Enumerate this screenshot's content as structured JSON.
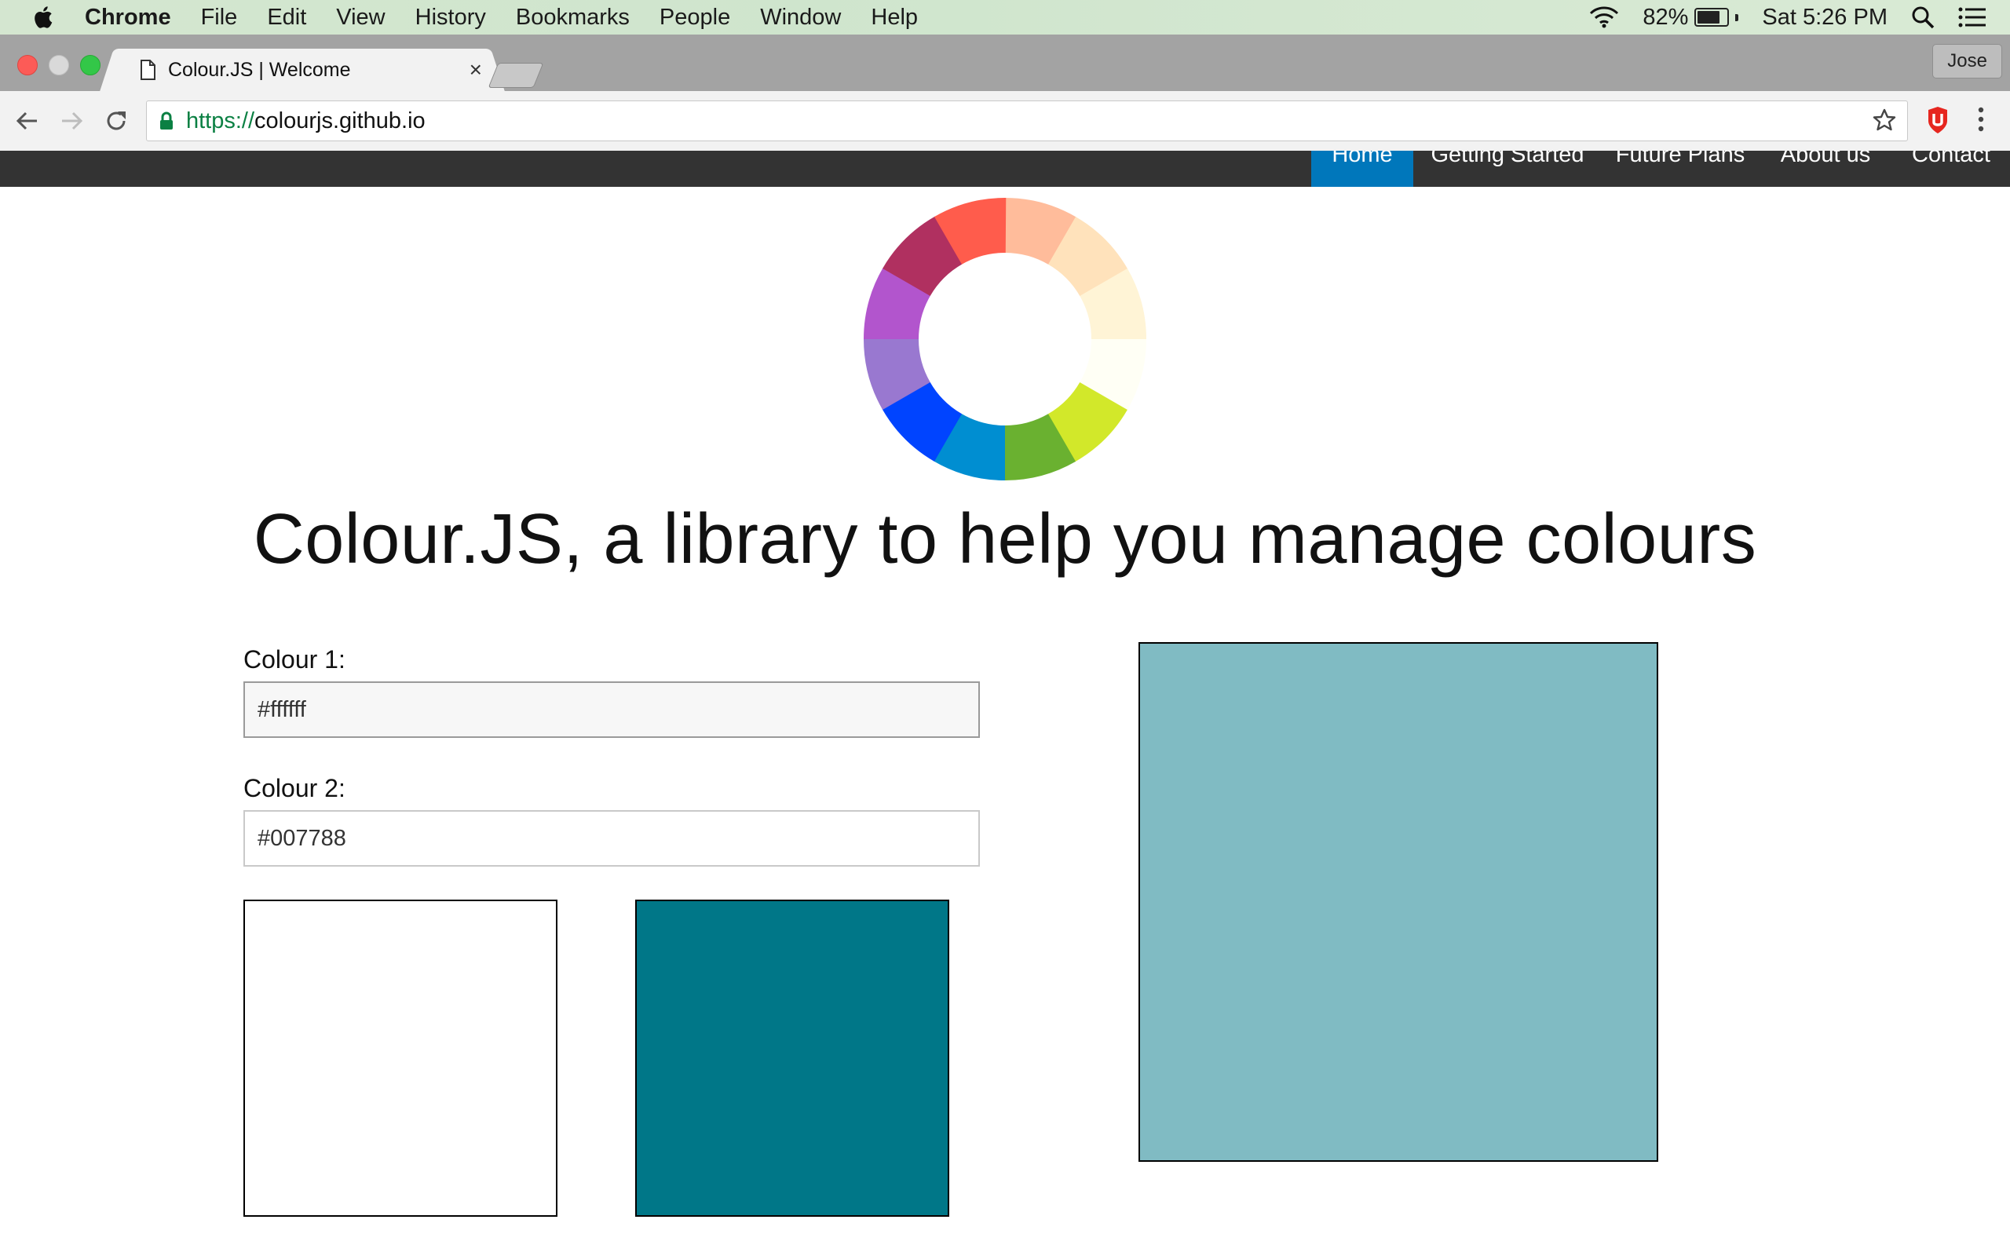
{
  "menubar": {
    "items": [
      "Chrome",
      "File",
      "Edit",
      "View",
      "History",
      "Bookmarks",
      "People",
      "Window",
      "Help"
    ],
    "battery": "82%",
    "battery_level": 0.82,
    "clock": "Sat 5:26 PM",
    "icons": [
      "apple-icon",
      "wifi-icon",
      "battery-icon",
      "spotlight-icon",
      "notification-center-icon"
    ]
  },
  "browser": {
    "tab_title": "Colour.JS | Welcome",
    "tab_close": "×",
    "profile": "Jose",
    "url_scheme": "https://",
    "url_host": "colourjs.github.io"
  },
  "site_nav": {
    "items": [
      "Home",
      "Getting Started",
      "Future Plans",
      "About us",
      "Contact"
    ],
    "active": "Home",
    "active_color": "#0077bb",
    "bar_color": "#333333"
  },
  "logo": {
    "segment_colors": [
      "#ffbc9b",
      "#ffe2bb",
      "#fff4d6",
      "#fffff5",
      "#d2e82a",
      "#6ab130",
      "#008ed1",
      "#0044ff",
      "#9978d0",
      "#b255cd",
      "#b03060",
      "#ff5c4c"
    ]
  },
  "main": {
    "headline": "Colour.JS, a library to help you manage colours",
    "colour1_label": "Colour 1:",
    "colour1_value": "#ffffff",
    "colour2_label": "Colour 2:",
    "colour2_value": "#007788",
    "swatch1_color": "#ffffff",
    "swatch2_color": "#007788",
    "mixed_color": "#80bbc3"
  }
}
